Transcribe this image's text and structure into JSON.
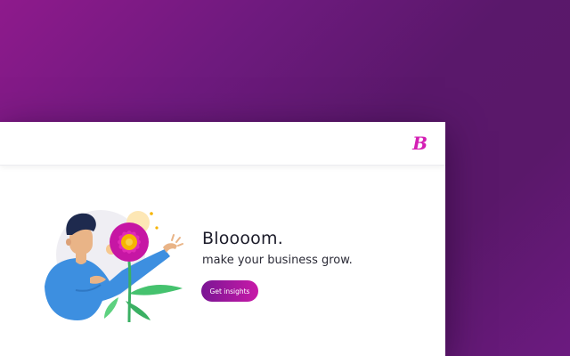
{
  "header": {
    "logo_text": "B"
  },
  "hero": {
    "title": "Bloooom.",
    "subtitle": "make your business grow.",
    "cta_label": "Get insights"
  },
  "colors": {
    "brand_pink": "#d41fb4",
    "cta_gradient_start": "#7a1594",
    "cta_gradient_end": "#c81aa8",
    "background_purple": "#5a186b"
  },
  "icons": {
    "logo": "brand-b-logo",
    "illustration": "person-with-flower-illustration"
  }
}
